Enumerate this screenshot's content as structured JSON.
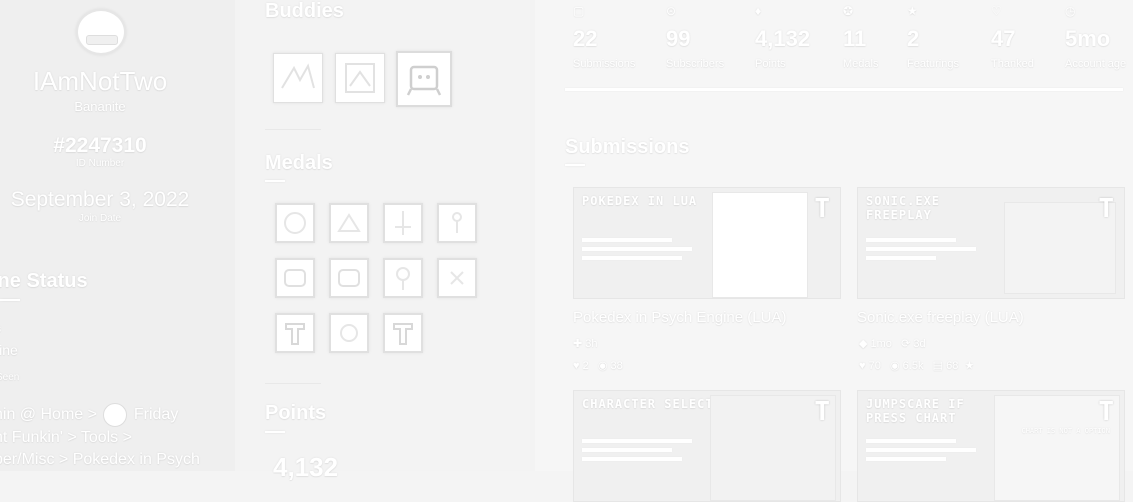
{
  "profile": {
    "username": "IAmNotTwo",
    "rank": "Bananite",
    "id_number": "#2247310",
    "id_label": "ID Number",
    "join_date": "September 3, 2022",
    "join_label": "Join Date"
  },
  "online_status": {
    "heading": "ine Status",
    "status_label": "s",
    "status_value": "line",
    "seen_label": "Seen",
    "location_line1": "nin @ Home >",
    "location_line1b": "Friday",
    "location_line2": "ht Funkin' > Tools >",
    "location_line3": "per/Misc > Pokedex in Psych"
  },
  "buddies": {
    "heading": "Buddies"
  },
  "medals": {
    "heading": "Medals"
  },
  "points": {
    "heading": "Points",
    "value": "4,132"
  },
  "stats": [
    {
      "icon": "submissions-icon",
      "glyph": "▢",
      "value": "22",
      "label": "Submissions"
    },
    {
      "icon": "subscribers-icon",
      "glyph": "⊙",
      "value": "99",
      "label": "Subscribers"
    },
    {
      "icon": "points-icon",
      "glyph": "♦",
      "value": "4,132",
      "label": "Points"
    },
    {
      "icon": "medals-icon",
      "glyph": "✪",
      "value": "11",
      "label": "Medals"
    },
    {
      "icon": "featurings-icon",
      "glyph": "★",
      "value": "2",
      "label": "Featurings"
    },
    {
      "icon": "thanked-icon",
      "glyph": "♡",
      "value": "47",
      "label": "Thanked"
    },
    {
      "icon": "account-age-icon",
      "glyph": "◷",
      "value": "5mo",
      "label": "Account age"
    }
  ],
  "submissions": {
    "heading": "Submissions",
    "items": [
      {
        "thumb_title": "POKEDEX IN LUA",
        "title": "Pokedex in Psych Engine (LUA)",
        "age": "3h",
        "likes": "2",
        "views": "38"
      },
      {
        "thumb_title": "SONIC.EXE FREEPLAY",
        "title": "Sonic.exe freeplay (LUA)",
        "age": "1mo",
        "updated": "3d",
        "likes": "70",
        "views": "6.5k",
        "comments": "68"
      },
      {
        "thumb_title": "CHARACTER SELECT",
        "title": ""
      },
      {
        "thumb_title": "JUMPSCARE IF PRESS CHART",
        "thumb_sub": "CHART IS NOT A OPTION",
        "title": ""
      }
    ]
  }
}
